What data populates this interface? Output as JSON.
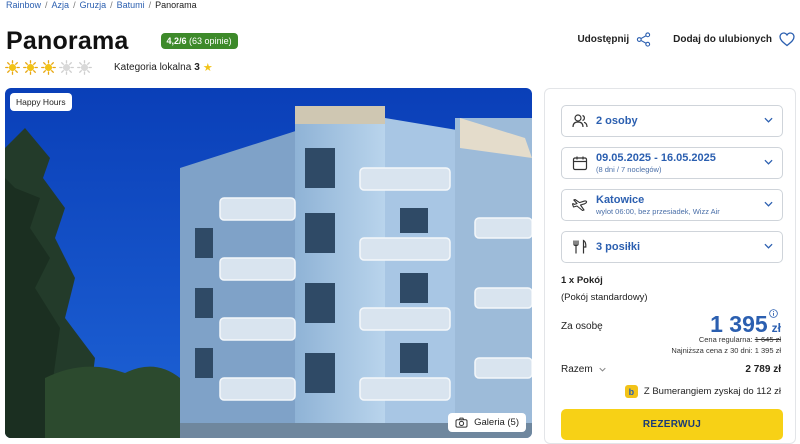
{
  "breadcrumb": {
    "items": [
      "Rainbow",
      "Azja",
      "Gruzja",
      "Batumi"
    ],
    "current": "Panorama",
    "separator": "/"
  },
  "hotel": {
    "name": "Panorama",
    "rating_score": "4,2/6",
    "rating_count": "(63 opinie)",
    "stars_filled": 3,
    "stars_total": 5,
    "category_label": "Kategoria lokalna",
    "category_value": "3"
  },
  "actions": {
    "share_label": "Udostępnij",
    "favorite_label": "Dodaj do ulubionych"
  },
  "photo": {
    "badge": "Happy Hours",
    "gallery_label": "Galeria (5)"
  },
  "booking": {
    "persons": "2 osoby",
    "dates": "09.05.2025 - 16.05.2025",
    "dates_sub": "(8 dni / 7 noclegów)",
    "departure": "Katowice",
    "departure_sub": "wylot 06:00, bez przesiadek, Wizz Air",
    "meals": "3 posiłki",
    "room_count": "1 x Pokój",
    "room_type": "(Pokój standardowy)",
    "per_person_label": "Za osobę",
    "price": "1 395",
    "currency": "zł",
    "regular_label": "Cena regularna:",
    "regular_price": "1 645 zł",
    "lowest_label": "Najniższa cena z 30 dni: 1 395 zł",
    "total_label": "Razem",
    "total_value": "2 789 zł",
    "bumerang_text": "Z Bumerangiem zyskaj do 112 zł",
    "reserve_label": "REZERWUJ"
  },
  "colors": {
    "accent_blue": "#2b5fb0",
    "rating_green": "#3d8a2a",
    "reserve_yellow": "#f7d116",
    "sun_yellow": "#f2c318"
  }
}
